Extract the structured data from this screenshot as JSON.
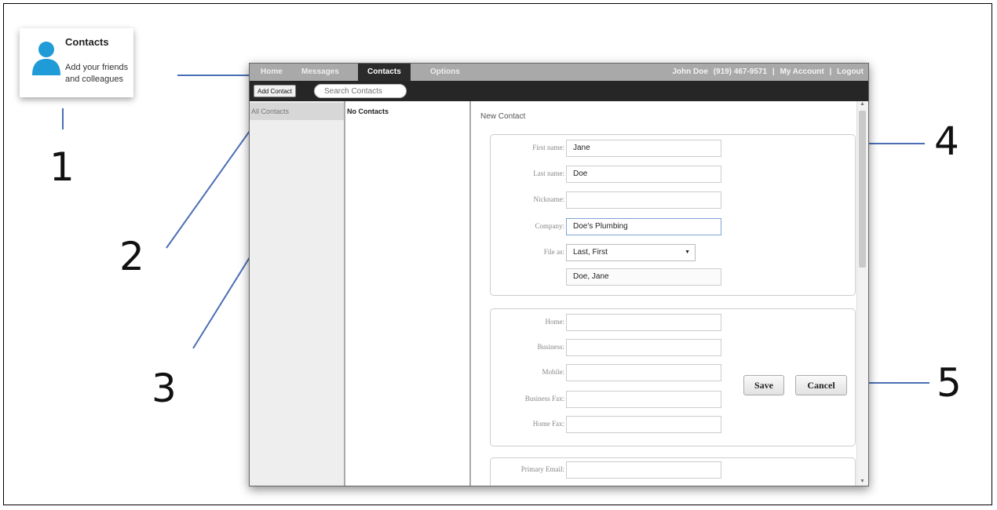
{
  "callout_card": {
    "title": "Contacts",
    "description": "Add your friends and colleagues",
    "icon": "person-icon",
    "icon_color": "#1f9bd7"
  },
  "callout_numbers": [
    "1",
    "2",
    "3",
    "4",
    "5"
  ],
  "callout_line_color": "#4a6fb5",
  "nav": {
    "tabs": [
      "Home",
      "Messages",
      "Contacts",
      "Options"
    ],
    "active_tab": "Contacts",
    "user_name": "John Doe",
    "user_phone": "(919) 467-9571",
    "my_account": "My Account",
    "separator": "|",
    "logout": "Logout"
  },
  "toolbar": {
    "add_contact_label": "Add Contact",
    "search_placeholder": "Search Contacts"
  },
  "groups": {
    "items": [
      "All Contacts"
    ]
  },
  "contacts_list": {
    "empty_text": "No Contacts"
  },
  "form": {
    "title": "New Contact",
    "name_section": {
      "first_name_label": "First name:",
      "first_name_value": "Jane",
      "last_name_label": "Last name:",
      "last_name_value": "Doe",
      "nickname_label": "Nickname:",
      "nickname_value": "",
      "company_label": "Company:",
      "company_value": "Doe's Plumbing",
      "file_as_label": "File as:",
      "file_as_selected": "Last, First",
      "file_as_preview": "Doe, Jane"
    },
    "phone_section": {
      "home_label": "Home:",
      "business_label": "Business:",
      "mobile_label": "Mobile:",
      "business_fax_label": "Business Fax:",
      "home_fax_label": "Home Fax:"
    },
    "email_section": {
      "primary_email_label": "Primary Email:"
    },
    "save_label": "Save",
    "cancel_label": "Cancel"
  },
  "colors": {
    "nav_bar": "#a9a9a9",
    "toolbar": "#262626",
    "active_tab": "#2b2b2b",
    "focus_border": "#7fa3d6"
  }
}
